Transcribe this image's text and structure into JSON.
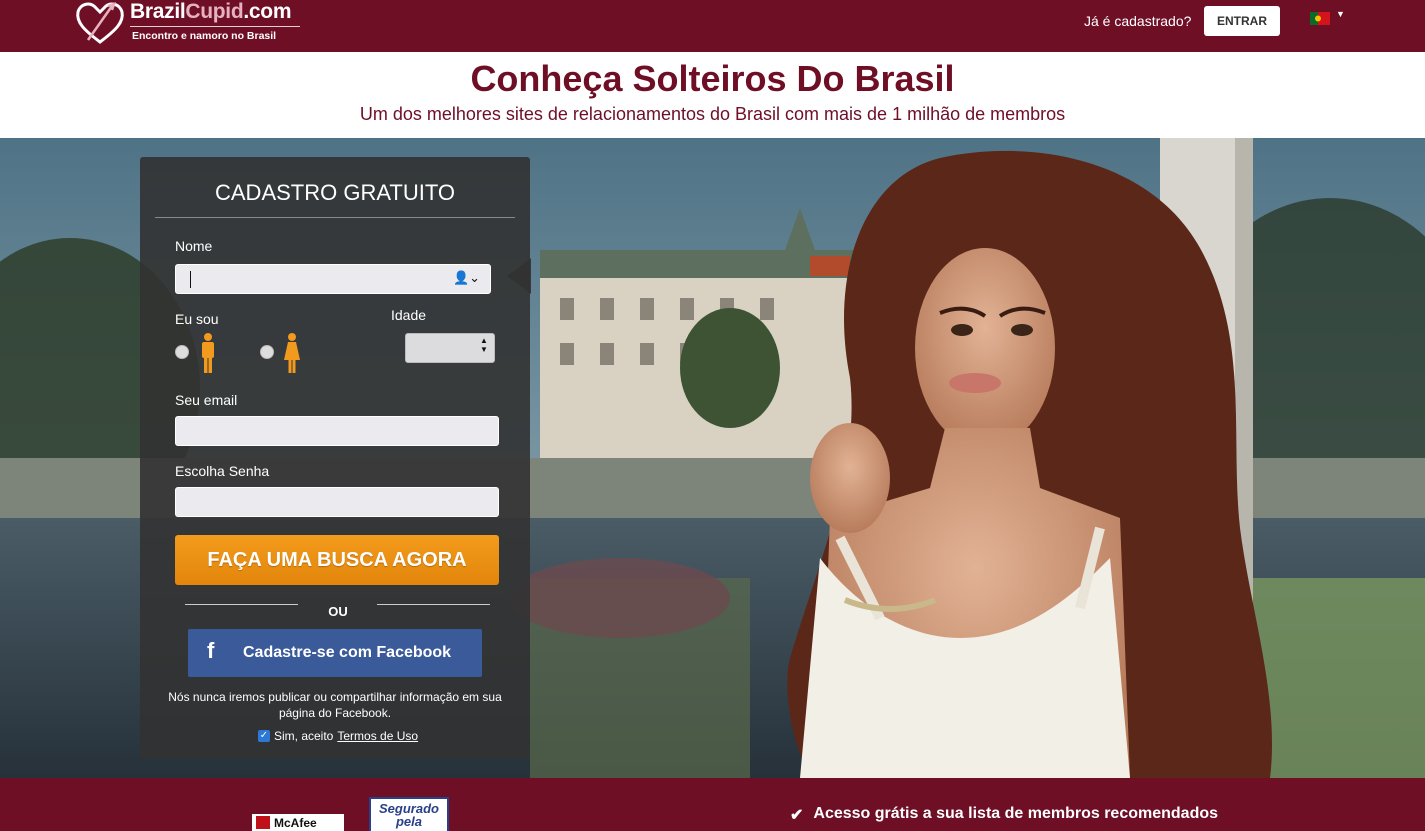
{
  "header": {
    "logo_brand": "Brazil",
    "logo_brand_accent": "Cupid",
    "logo_domain": ".com",
    "logo_tagline": "Encontro e namoro no Brasil",
    "already_member": "Já é cadastrado?",
    "login_label": "ENTRAR",
    "language_flag": "portugal-flag-icon"
  },
  "hero": {
    "headline": "Conheça Solteiros Do Brasil",
    "subheadline": "Um dos melhores sites de relacionamentos do Brasil com mais de 1 milhão de membros"
  },
  "signup": {
    "title": "CADASTRO GRATUITO",
    "name_label": "Nome",
    "name_value": "",
    "gender_label": "Eu sou",
    "age_label": "Idade",
    "age_value": "",
    "email_label": "Seu email",
    "email_value": "",
    "password_label": "Escolha Senha",
    "password_value": "",
    "cta_label": "FAÇA UMA BUSCA AGORA",
    "or_label": "OU",
    "facebook_label": "Cadastre-se com Facebook",
    "facebook_notice": "Nós nunca iremos publicar ou compartilhar informação em sua página do Facebook.",
    "terms_prefix": "Sim, aceito",
    "terms_link": "Termos de Uso",
    "terms_checked": true
  },
  "footer": {
    "mcafee_label": "McAfee",
    "seal_line1": "Segurado",
    "seal_line2": "pela",
    "benefit_1": "Acesso grátis a sua lista de membros recomendados"
  },
  "colors": {
    "brand": "#6e0f26",
    "cta": "#f39b1c",
    "facebook": "#3b5a9a"
  }
}
